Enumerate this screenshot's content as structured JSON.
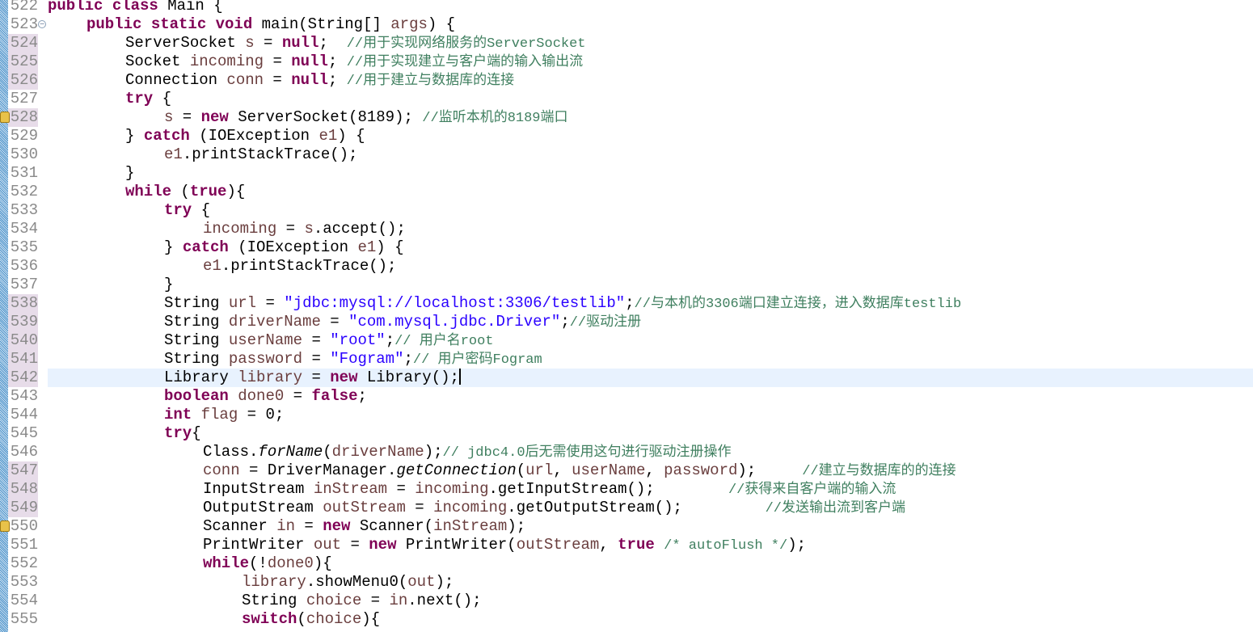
{
  "editor": {
    "colors": {
      "keyword": "#7f0055",
      "variable": "#6a3e3e",
      "string": "#2a00ff",
      "comment": "#3f7f5f",
      "current_line": "#e8f2fe",
      "changed_gutter": "#e7dce9"
    },
    "lines": [
      {
        "n": "522",
        "indent": 0,
        "t": [
          [
            "k",
            "public class"
          ],
          [
            "p",
            " Main {"
          ]
        ]
      },
      {
        "n": "523",
        "indent": 1,
        "fold": true,
        "t": [
          [
            "k",
            "public static void"
          ],
          [
            "p",
            " main(String[] "
          ],
          [
            "v",
            "args"
          ],
          [
            "p",
            ") {"
          ]
        ]
      },
      {
        "n": "524",
        "indent": 2,
        "changed": true,
        "t": [
          [
            "p",
            "ServerSocket "
          ],
          [
            "v",
            "s"
          ],
          [
            "p",
            " = "
          ],
          [
            "k",
            "null"
          ],
          [
            "p",
            ";  "
          ],
          [
            "c",
            "//用于实现网络服务的ServerSocket"
          ]
        ]
      },
      {
        "n": "525",
        "indent": 2,
        "changed": true,
        "t": [
          [
            "p",
            "Socket "
          ],
          [
            "v",
            "incoming"
          ],
          [
            "p",
            " = "
          ],
          [
            "k",
            "null"
          ],
          [
            "p",
            "; "
          ],
          [
            "c",
            "//用于实现建立与客户端的输入输出流"
          ]
        ]
      },
      {
        "n": "526",
        "indent": 2,
        "changed": true,
        "t": [
          [
            "p",
            "Connection "
          ],
          [
            "v",
            "conn"
          ],
          [
            "p",
            " = "
          ],
          [
            "k",
            "null"
          ],
          [
            "p",
            "; "
          ],
          [
            "c",
            "//用于建立与数据库的连接"
          ]
        ]
      },
      {
        "n": "527",
        "indent": 2,
        "t": [
          [
            "k",
            "try"
          ],
          [
            "p",
            " {"
          ]
        ]
      },
      {
        "n": "528",
        "indent": 3,
        "changed": true,
        "warn": true,
        "t": [
          [
            "v",
            "s"
          ],
          [
            "p",
            " = "
          ],
          [
            "k",
            "new"
          ],
          [
            "p",
            " ServerSocket(8189); "
          ],
          [
            "c",
            "//监听本机的8189端口"
          ]
        ]
      },
      {
        "n": "529",
        "indent": 2,
        "t": [
          [
            "p",
            "} "
          ],
          [
            "k",
            "catch"
          ],
          [
            "p",
            " (IOException "
          ],
          [
            "v",
            "e1"
          ],
          [
            "p",
            ") {"
          ]
        ]
      },
      {
        "n": "530",
        "indent": 3,
        "t": [
          [
            "v",
            "e1"
          ],
          [
            "p",
            ".printStackTrace();"
          ]
        ]
      },
      {
        "n": "531",
        "indent": 2,
        "t": [
          [
            "p",
            "}"
          ]
        ]
      },
      {
        "n": "532",
        "indent": 2,
        "t": [
          [
            "k",
            "while"
          ],
          [
            "p",
            " ("
          ],
          [
            "k",
            "true"
          ],
          [
            "p",
            "){"
          ]
        ]
      },
      {
        "n": "533",
        "indent": 3,
        "t": [
          [
            "k",
            "try"
          ],
          [
            "p",
            " {"
          ]
        ]
      },
      {
        "n": "534",
        "indent": 4,
        "t": [
          [
            "v",
            "incoming"
          ],
          [
            "p",
            " = "
          ],
          [
            "v",
            "s"
          ],
          [
            "p",
            ".accept();"
          ]
        ]
      },
      {
        "n": "535",
        "indent": 3,
        "t": [
          [
            "p",
            "} "
          ],
          [
            "k",
            "catch"
          ],
          [
            "p",
            " (IOException "
          ],
          [
            "v",
            "e1"
          ],
          [
            "p",
            ") {"
          ]
        ]
      },
      {
        "n": "536",
        "indent": 4,
        "t": [
          [
            "v",
            "e1"
          ],
          [
            "p",
            ".printStackTrace();"
          ]
        ]
      },
      {
        "n": "537",
        "indent": 3,
        "t": [
          [
            "p",
            "}"
          ]
        ]
      },
      {
        "n": "538",
        "indent": 3,
        "changed": true,
        "t": [
          [
            "p",
            "String "
          ],
          [
            "v",
            "url"
          ],
          [
            "p",
            " = "
          ],
          [
            "s",
            "\"jdbc:mysql://localhost:3306/testlib\""
          ],
          [
            "p",
            ";"
          ],
          [
            "c",
            "//与本机的3306端口建立连接，进入数据库testlib"
          ]
        ]
      },
      {
        "n": "539",
        "indent": 3,
        "changed": true,
        "t": [
          [
            "p",
            "String "
          ],
          [
            "v",
            "driverName"
          ],
          [
            "p",
            " = "
          ],
          [
            "s",
            "\"com.mysql.jdbc.Driver\""
          ],
          [
            "p",
            ";"
          ],
          [
            "c",
            "//驱动注册"
          ]
        ]
      },
      {
        "n": "540",
        "indent": 3,
        "changed": true,
        "t": [
          [
            "p",
            "String "
          ],
          [
            "v",
            "userName"
          ],
          [
            "p",
            " = "
          ],
          [
            "s",
            "\"root\""
          ],
          [
            "p",
            ";"
          ],
          [
            "c",
            "// 用户名root"
          ]
        ]
      },
      {
        "n": "541",
        "indent": 3,
        "changed": true,
        "t": [
          [
            "p",
            "String "
          ],
          [
            "v",
            "password"
          ],
          [
            "p",
            " = "
          ],
          [
            "s",
            "\"Fogram\""
          ],
          [
            "p",
            ";"
          ],
          [
            "c",
            "// 用户密码Fogram"
          ]
        ]
      },
      {
        "n": "542",
        "indent": 3,
        "changed": true,
        "current": true,
        "t": [
          [
            "p",
            "Library "
          ],
          [
            "v",
            "library"
          ],
          [
            "p",
            " = "
          ],
          [
            "k",
            "new"
          ],
          [
            "p",
            " Library();"
          ]
        ]
      },
      {
        "n": "543",
        "indent": 3,
        "t": [
          [
            "k",
            "boolean"
          ],
          [
            "p",
            " "
          ],
          [
            "v",
            "done0"
          ],
          [
            "p",
            " = "
          ],
          [
            "k",
            "false"
          ],
          [
            "p",
            ";"
          ]
        ]
      },
      {
        "n": "544",
        "indent": 3,
        "t": [
          [
            "k",
            "int"
          ],
          [
            "p",
            " "
          ],
          [
            "v",
            "flag"
          ],
          [
            "p",
            " = 0;"
          ]
        ]
      },
      {
        "n": "545",
        "indent": 3,
        "t": [
          [
            "k",
            "try"
          ],
          [
            "p",
            "{"
          ]
        ]
      },
      {
        "n": "546",
        "indent": 4,
        "t": [
          [
            "p",
            "Class."
          ],
          [
            "i",
            "forName"
          ],
          [
            "p",
            "("
          ],
          [
            "v",
            "driverName"
          ],
          [
            "p",
            ");"
          ],
          [
            "c",
            "// jdbc4.0后无需使用这句进行驱动注册操作"
          ]
        ]
      },
      {
        "n": "547",
        "indent": 4,
        "changed": true,
        "t": [
          [
            "v",
            "conn"
          ],
          [
            "p",
            " = DriverManager."
          ],
          [
            "i",
            "getConnection"
          ],
          [
            "p",
            "("
          ],
          [
            "v",
            "url"
          ],
          [
            "p",
            ", "
          ],
          [
            "v",
            "userName"
          ],
          [
            "p",
            ", "
          ],
          [
            "v",
            "password"
          ],
          [
            "p",
            ");     "
          ],
          [
            "c",
            "//建立与数据库的的连接"
          ]
        ]
      },
      {
        "n": "548",
        "indent": 4,
        "changed": true,
        "t": [
          [
            "p",
            "InputStream "
          ],
          [
            "v",
            "inStream"
          ],
          [
            "p",
            " = "
          ],
          [
            "v",
            "incoming"
          ],
          [
            "p",
            ".getInputStream();        "
          ],
          [
            "c",
            "//获得来自客户端的输入流"
          ]
        ]
      },
      {
        "n": "549",
        "indent": 4,
        "changed": true,
        "t": [
          [
            "p",
            "OutputStream "
          ],
          [
            "v",
            "outStream"
          ],
          [
            "p",
            " = "
          ],
          [
            "v",
            "incoming"
          ],
          [
            "p",
            ".getOutputStream();         "
          ],
          [
            "c",
            "//发送输出流到客户端"
          ]
        ]
      },
      {
        "n": "550",
        "indent": 4,
        "warn": true,
        "t": [
          [
            "p",
            "Scanner "
          ],
          [
            "v",
            "in"
          ],
          [
            "p",
            " = "
          ],
          [
            "k",
            "new"
          ],
          [
            "p",
            " Scanner("
          ],
          [
            "v",
            "inStream"
          ],
          [
            "p",
            ");"
          ]
        ]
      },
      {
        "n": "551",
        "indent": 4,
        "t": [
          [
            "p",
            "PrintWriter "
          ],
          [
            "v",
            "out"
          ],
          [
            "p",
            " = "
          ],
          [
            "k",
            "new"
          ],
          [
            "p",
            " PrintWriter("
          ],
          [
            "v",
            "outStream"
          ],
          [
            "p",
            ", "
          ],
          [
            "k",
            "true"
          ],
          [
            "p",
            " "
          ],
          [
            "c",
            "/* autoFlush */"
          ],
          [
            "p",
            ");"
          ]
        ]
      },
      {
        "n": "552",
        "indent": 4,
        "t": [
          [
            "k",
            "while"
          ],
          [
            "p",
            "(!"
          ],
          [
            "v",
            "done0"
          ],
          [
            "p",
            "){"
          ]
        ]
      },
      {
        "n": "553",
        "indent": 5,
        "t": [
          [
            "v",
            "library"
          ],
          [
            "p",
            ".showMenu0("
          ],
          [
            "v",
            "out"
          ],
          [
            "p",
            ");"
          ]
        ]
      },
      {
        "n": "554",
        "indent": 5,
        "t": [
          [
            "p",
            "String "
          ],
          [
            "v",
            "choice"
          ],
          [
            "p",
            " = "
          ],
          [
            "v",
            "in"
          ],
          [
            "p",
            ".next();"
          ]
        ]
      },
      {
        "n": "555",
        "indent": 5,
        "t": [
          [
            "k",
            "switch"
          ],
          [
            "p",
            "("
          ],
          [
            "v",
            "choice"
          ],
          [
            "p",
            "){"
          ]
        ]
      }
    ]
  }
}
